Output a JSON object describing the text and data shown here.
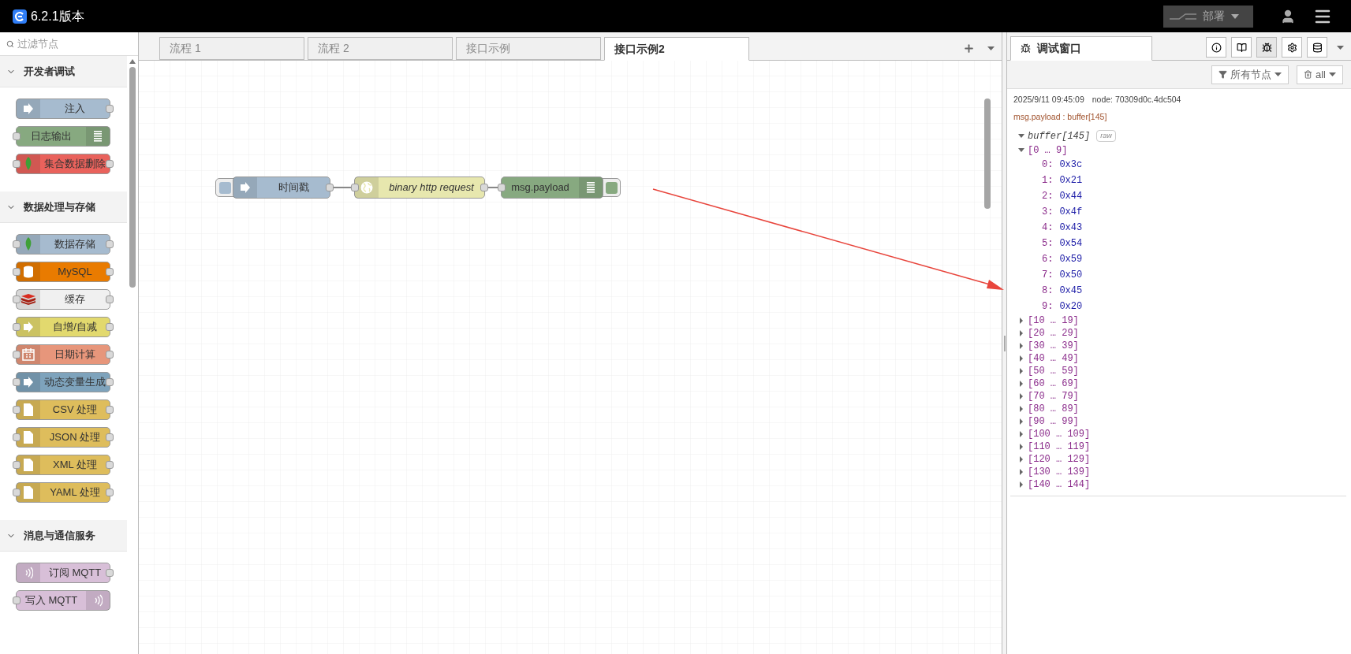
{
  "header": {
    "title": "6.2.1版本",
    "deploy_label": "部署"
  },
  "palette": {
    "filter_placeholder": "过滤节点",
    "categories": [
      {
        "label": "开发者调试",
        "expanded": true,
        "nodes": [
          {
            "label": "注入",
            "color": "#a6bbcf",
            "kind": "arrow",
            "inputs": false,
            "outputs": true,
            "icon_right": false
          },
          {
            "label": "日志输出",
            "color": "#87a980",
            "kind": "lines",
            "inputs": true,
            "outputs": false,
            "icon_right": true
          },
          {
            "label": "集合数据删除",
            "color": "#e9625c",
            "kind": "leaf",
            "inputs": true,
            "outputs": true,
            "icon_right": false
          }
        ]
      },
      {
        "label": "数据处理与存储",
        "expanded": true,
        "nodes": [
          {
            "label": "数据存储",
            "color": "#a6bbcf",
            "kind": "leaf",
            "inputs": true,
            "outputs": true,
            "icon_right": false
          },
          {
            "label": "MySQL",
            "color": "#e97b00",
            "kind": "cylinder",
            "inputs": true,
            "outputs": true,
            "icon_right": false
          },
          {
            "label": "缓存",
            "color": "#f0f0f0",
            "kind": "stack",
            "inputs": true,
            "outputs": true,
            "icon_right": false
          },
          {
            "label": "自增/自减",
            "color": "#e2d96e",
            "kind": "arrow",
            "inputs": true,
            "outputs": true,
            "icon_right": false
          },
          {
            "label": "日期计算",
            "color": "#e7967b",
            "kind": "calendar",
            "inputs": true,
            "outputs": true,
            "icon_right": false
          },
          {
            "label": "动态变量生成",
            "color": "#7ea3bc",
            "kind": "arrow",
            "inputs": true,
            "outputs": true,
            "icon_right": false
          },
          {
            "label": "CSV 处理",
            "color": "#debd5c",
            "kind": "file",
            "inputs": true,
            "outputs": true,
            "icon_right": false
          },
          {
            "label": "JSON 处理",
            "color": "#debd5c",
            "kind": "file",
            "inputs": true,
            "outputs": true,
            "icon_right": false
          },
          {
            "label": "XML 处理",
            "color": "#debd5c",
            "kind": "file",
            "inputs": true,
            "outputs": true,
            "icon_right": false
          },
          {
            "label": "YAML 处理",
            "color": "#debd5c",
            "kind": "file",
            "inputs": true,
            "outputs": true,
            "icon_right": false
          }
        ]
      },
      {
        "label": "消息与通信服务",
        "expanded": true,
        "nodes": [
          {
            "label": "订阅 MQTT",
            "color": "#d8bfd8",
            "kind": "wave",
            "inputs": false,
            "outputs": true,
            "icon_right": false
          },
          {
            "label": "写入 MQTT",
            "color": "#d8bfd8",
            "kind": "wave",
            "inputs": true,
            "outputs": false,
            "icon_right": true
          }
        ]
      }
    ]
  },
  "tabs": [
    {
      "label": "流程 1",
      "selected": false
    },
    {
      "label": "流程 2",
      "selected": false
    },
    {
      "label": "接口示例",
      "selected": false
    },
    {
      "label": "接口示例2",
      "selected": true
    }
  ],
  "flow": [
    {
      "label": "时间戳",
      "color": "#a6bbcf",
      "kind": "inject",
      "italic": false,
      "inputs": false,
      "outputs": true,
      "icon_right": false
    },
    {
      "label": "binary http request",
      "color": "#e7e7ae",
      "kind": "http",
      "italic": true,
      "inputs": true,
      "outputs": true,
      "icon_right": false
    },
    {
      "label": "msg.payload",
      "color": "#87a980",
      "kind": "debug",
      "italic": false,
      "inputs": true,
      "outputs": false,
      "icon_right": true
    }
  ],
  "sidebar": {
    "tab_label": "调试窗口",
    "filter_label": "所有节点",
    "clear_label": "all",
    "message": {
      "time": "2025/9/11 09:45:09",
      "node": "node: 70309d0c.4dc504",
      "topic": "msg.payload : buffer[145]",
      "tree": {
        "label": "buffer[145]",
        "raw_label": "raw",
        "expanded": true,
        "children": [
          {
            "label": "[0 … 9]",
            "expanded": true,
            "children": [
              {
                "key": "0:",
                "value": "0x3c"
              },
              {
                "key": "1:",
                "value": "0x21"
              },
              {
                "key": "2:",
                "value": "0x44"
              },
              {
                "key": "3:",
                "value": "0x4f"
              },
              {
                "key": "4:",
                "value": "0x43"
              },
              {
                "key": "5:",
                "value": "0x54"
              },
              {
                "key": "6:",
                "value": "0x59"
              },
              {
                "key": "7:",
                "value": "0x50"
              },
              {
                "key": "8:",
                "value": "0x45"
              },
              {
                "key": "9:",
                "value": "0x20"
              }
            ]
          },
          {
            "label": "[10 … 19]",
            "expanded": false
          },
          {
            "label": "[20 … 29]",
            "expanded": false
          },
          {
            "label": "[30 … 39]",
            "expanded": false
          },
          {
            "label": "[40 … 49]",
            "expanded": false
          },
          {
            "label": "[50 … 59]",
            "expanded": false
          },
          {
            "label": "[60 … 69]",
            "expanded": false
          },
          {
            "label": "[70 … 79]",
            "expanded": false
          },
          {
            "label": "[80 … 89]",
            "expanded": false
          },
          {
            "label": "[90 … 99]",
            "expanded": false
          },
          {
            "label": "[100 … 109]",
            "expanded": false
          },
          {
            "label": "[110 … 119]",
            "expanded": false
          },
          {
            "label": "[120 … 129]",
            "expanded": false
          },
          {
            "label": "[130 … 139]",
            "expanded": false
          },
          {
            "label": "[140 … 144]",
            "expanded": false
          }
        ]
      }
    }
  }
}
